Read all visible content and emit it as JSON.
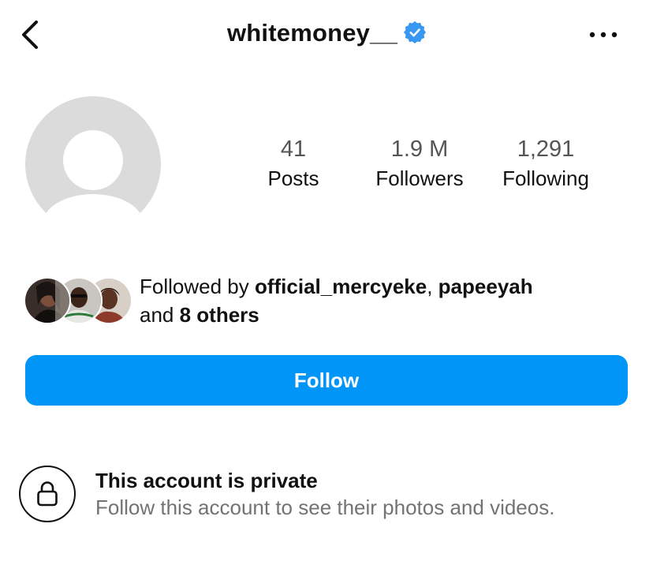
{
  "header": {
    "username": "whitemoney__",
    "verified": true,
    "icons": {
      "back": "chevron-left-icon",
      "verified": "verified-badge-icon",
      "more": "more-horizontal-icon"
    }
  },
  "profile": {
    "avatar": "default-avatar-icon",
    "stats": {
      "posts": {
        "value": "41",
        "label": "Posts"
      },
      "followers": {
        "value": "1.9 M",
        "label": "Followers"
      },
      "following": {
        "value": "1,291",
        "label": "Following"
      }
    }
  },
  "followed_by": {
    "prefix": "Followed by ",
    "user1": "official_mercyeke",
    "separator": ", ",
    "user2": "papeeyah",
    "and_text": "and ",
    "others": "8 others"
  },
  "follow_button": {
    "label": "Follow"
  },
  "private": {
    "title": "This account is private",
    "subtitle": "Follow this account to see their photos and videos.",
    "icon": "lock-icon"
  },
  "colors": {
    "accent": "#0095f6",
    "verified": "#3897f0",
    "placeholder": "#dbdbdb",
    "secondary_text": "#737373"
  }
}
